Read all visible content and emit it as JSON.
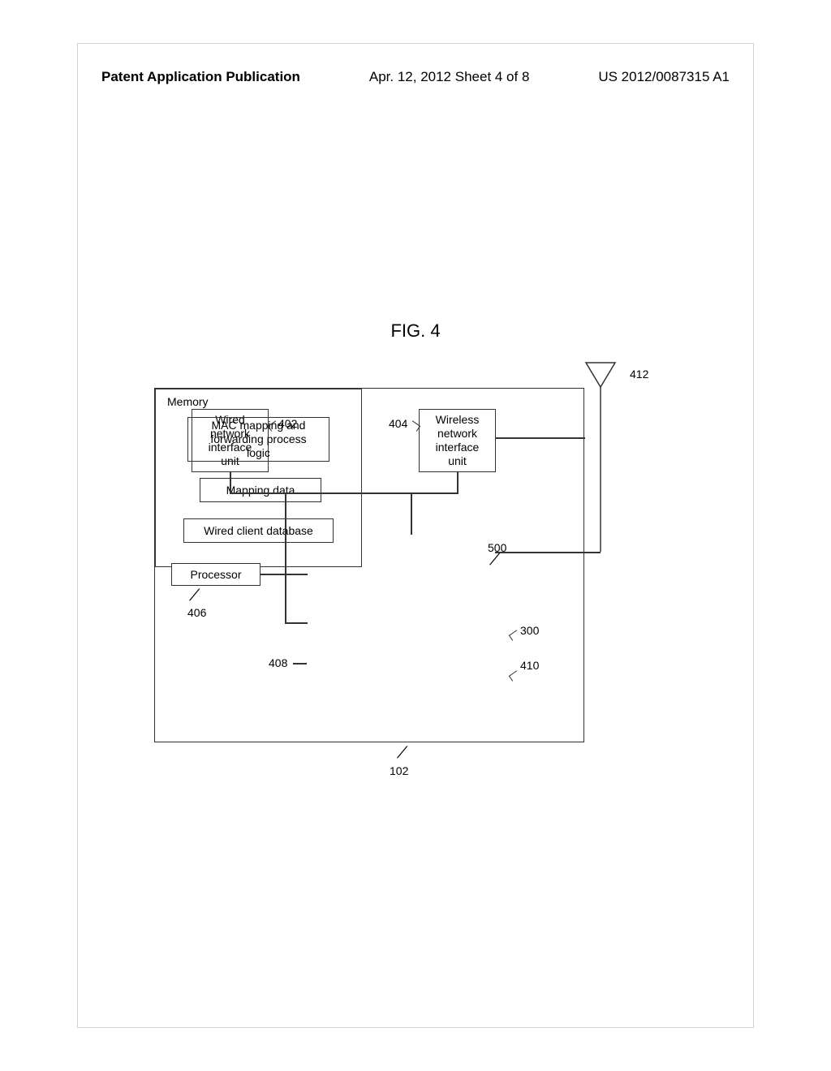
{
  "header": {
    "left": "Patent Application Publication",
    "center": "Apr. 12, 2012  Sheet 4 of 8",
    "right": "US 2012/0087315 A1"
  },
  "figure": {
    "title": "FIG. 4"
  },
  "boxes": {
    "wired_l1": "Wired",
    "wired_l2": "network",
    "wired_l3": "interface",
    "wired_l4": "unit",
    "wireless_l1": "Wireless",
    "wireless_l2": "network",
    "wireless_l3": "interface",
    "wireless_l4": "unit",
    "processor": "Processor",
    "memory": "Memory",
    "mac_l1": "MAC mapping and",
    "mac_l2": "forwarding process",
    "mac_l3": "logic",
    "mapping": "Mapping data",
    "database": "Wired client database"
  },
  "refs": {
    "r402": "402",
    "r404": "404",
    "r406": "406",
    "r408": "408",
    "r500": "500",
    "r300": "300",
    "r410": "410",
    "r412": "412",
    "r102": "102"
  }
}
